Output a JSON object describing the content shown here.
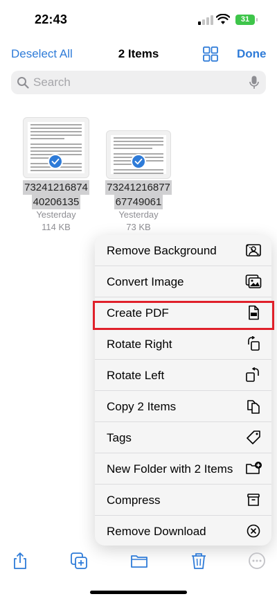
{
  "status": {
    "time": "22:43",
    "battery": "31"
  },
  "nav": {
    "deselect_label": "Deselect All",
    "title": "2 Items",
    "done_label": "Done"
  },
  "search": {
    "placeholder": "Search"
  },
  "files": [
    {
      "name_line1": "73241216874",
      "name_line2": "40206135",
      "date": "Yesterday",
      "size": "114 KB"
    },
    {
      "name_line1": "73241216877",
      "name_line2": "67749061",
      "date": "Yesterday",
      "size": "73 KB"
    }
  ],
  "menu": {
    "items": [
      {
        "label": "Remove Background",
        "icon": "remove-background-icon"
      },
      {
        "label": "Convert Image",
        "icon": "convert-image-icon"
      },
      {
        "label": "Create PDF",
        "icon": "pdf-document-icon"
      },
      {
        "label": "Rotate Right",
        "icon": "rotate-right-icon"
      },
      {
        "label": "Rotate Left",
        "icon": "rotate-left-icon"
      },
      {
        "label": "Copy 2 Items",
        "icon": "copy-icon"
      },
      {
        "label": "Tags",
        "icon": "tag-icon"
      },
      {
        "label": "New Folder with 2 Items",
        "icon": "new-folder-icon"
      },
      {
        "label": "Compress",
        "icon": "archive-box-icon"
      },
      {
        "label": "Remove Download",
        "icon": "circle-x-icon"
      }
    ],
    "highlighted": "Create PDF"
  },
  "toolbar": {
    "icons": [
      "share-icon",
      "duplicate-icon",
      "folder-icon",
      "trash-icon",
      "more-icon"
    ]
  },
  "colors": {
    "accent": "#2e7bd8",
    "highlight": "#e0202a",
    "battery": "#3ec54a"
  }
}
